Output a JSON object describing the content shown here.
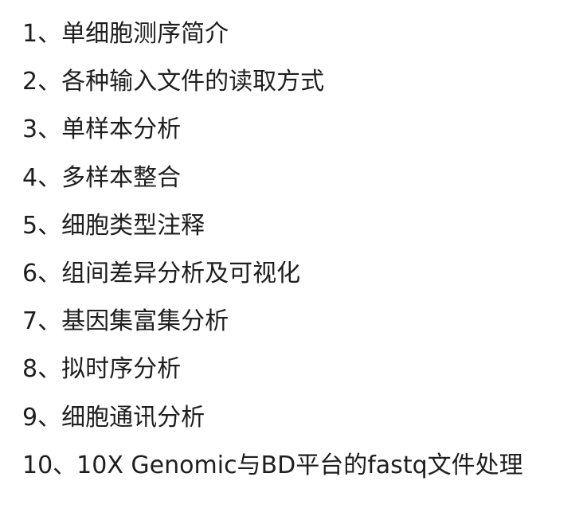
{
  "outline": {
    "items": [
      {
        "text": "1、单细胞测序简介"
      },
      {
        "text": "2、各种输入文件的读取方式"
      },
      {
        "text": "3、单样本分析"
      },
      {
        "text": "4、多样本整合"
      },
      {
        "text": "5、细胞类型注释"
      },
      {
        "text": "6、组间差异分析及可视化"
      },
      {
        "text": "7、基因集富集分析"
      },
      {
        "text": "8、拟时序分析"
      },
      {
        "text": "9、细胞通讯分析"
      },
      {
        "text": "10、10X Genomic与BD平台的fastq文件处理"
      }
    ]
  }
}
